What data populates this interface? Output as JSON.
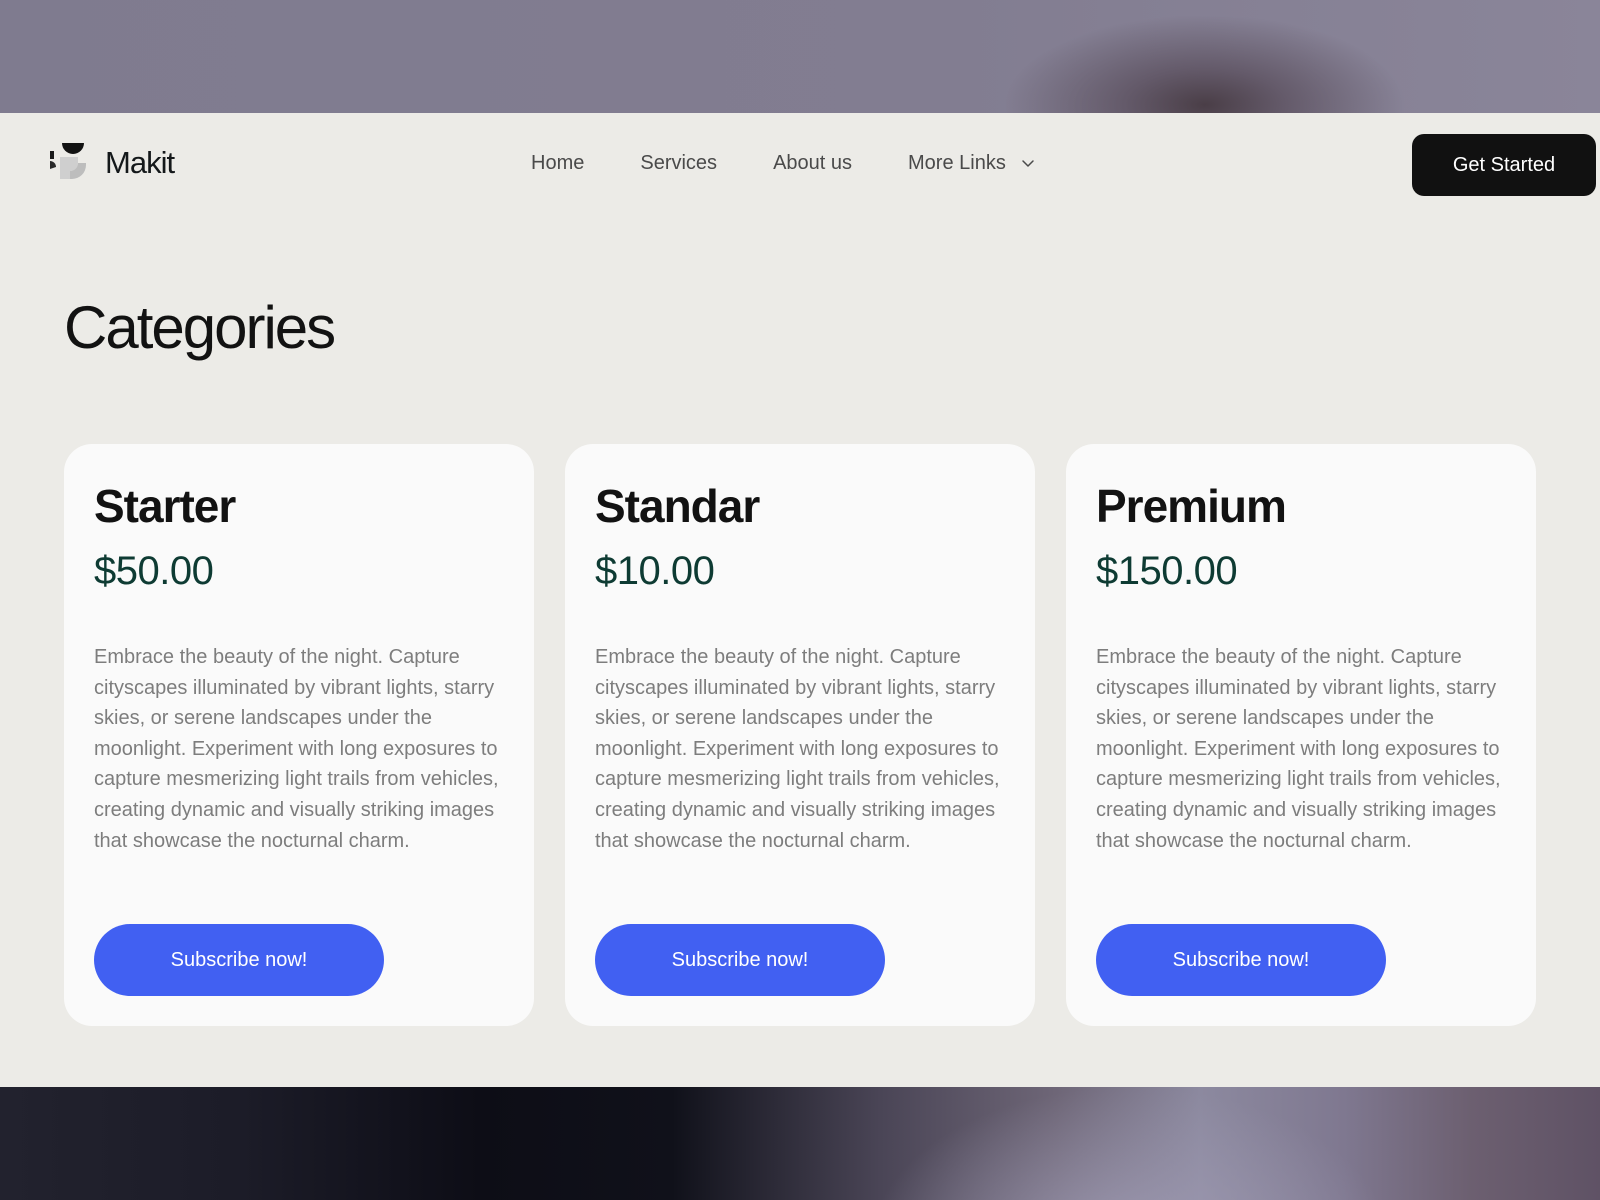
{
  "header": {
    "brand": "Makit",
    "nav": [
      "Home",
      "Services",
      "About us"
    ],
    "more_label": "More Links",
    "cta_label": "Get Started"
  },
  "page": {
    "title": "Categories"
  },
  "plans": [
    {
      "name": "Starter",
      "price": "$50.00",
      "description": "Embrace the beauty of the night. Capture cityscapes illuminated by vibrant lights, starry skies, or serene landscapes under the moonlight. Experiment with long exposures to capture mesmerizing light trails from vehicles, creating dynamic and visually striking images that showcase the nocturnal charm.",
      "button": "Subscribe now!"
    },
    {
      "name": "Standar",
      "price": "$10.00",
      "description": "Embrace the beauty of the night. Capture cityscapes illuminated by vibrant lights, starry skies, or serene landscapes under the moonlight. Experiment with long exposures to capture mesmerizing light trails from vehicles, creating dynamic and visually striking images that showcase the nocturnal charm.",
      "button": "Subscribe now!"
    },
    {
      "name": "Premium",
      "price": "$150.00",
      "description": "Embrace the beauty of the night. Capture cityscapes illuminated by vibrant lights, starry skies, or serene landscapes under the moonlight. Experiment with long exposures to capture mesmerizing light trails from vehicles, creating dynamic and visually striking images that showcase the nocturnal charm.",
      "button": "Subscribe now!"
    }
  ],
  "icons": {
    "logo": "makit-logo-icon",
    "dropdown": "chevron-down-icon"
  },
  "colors": {
    "accent": "#4160f2",
    "cta": "#111111",
    "price": "#0e3b33",
    "card_bg": "#fafafa",
    "page_bg": "#ecebe7"
  }
}
